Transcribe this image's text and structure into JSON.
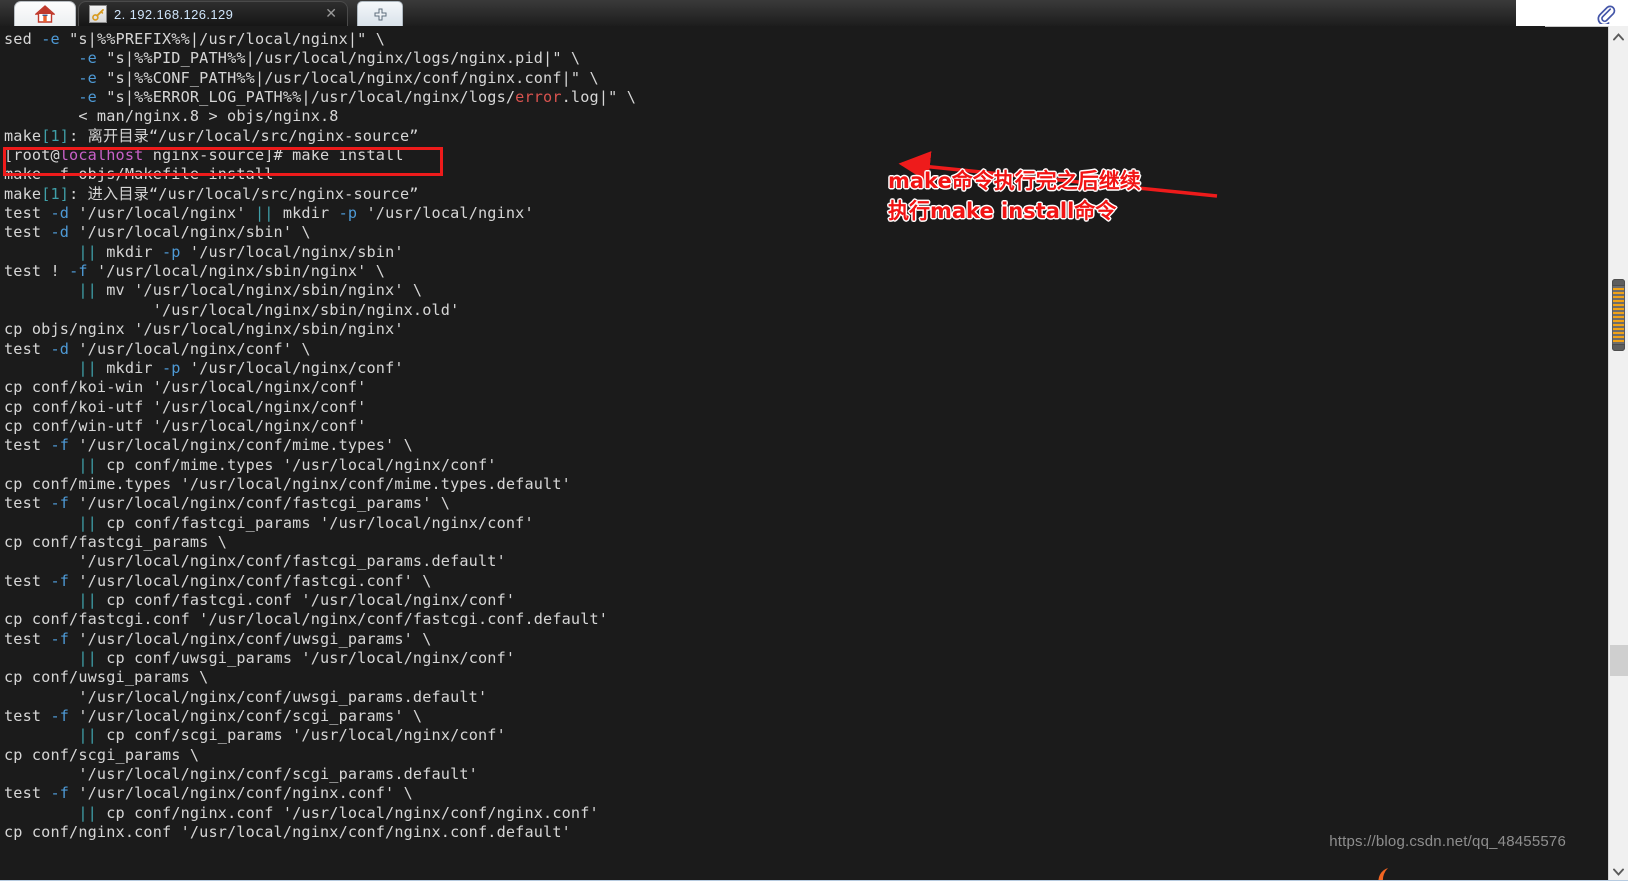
{
  "window": {
    "tabs": [
      {
        "name": "home-tab",
        "icon": "home-icon",
        "label": ""
      },
      {
        "name": "session-tab",
        "icon": "key-icon",
        "label": "2. 192.168.126.129",
        "close_label": "✕"
      },
      {
        "name": "new-tab",
        "icon": "plus-icon",
        "label": ""
      }
    ],
    "attach_icon": "paperclip-icon"
  },
  "terminal": {
    "lines": [
      {
        "segments": [
          {
            "t": "sed ",
            "c": "plain"
          },
          {
            "t": "-e",
            "c": "blue"
          },
          {
            "t": " \"s|%%PREFIX%%|/usr/local/nginx|\" \\",
            "c": "plain"
          }
        ]
      },
      {
        "segments": [
          {
            "t": "        ",
            "c": "plain"
          },
          {
            "t": "-e",
            "c": "blue"
          },
          {
            "t": " \"s|%%PID_PATH%%|/usr/local/nginx/logs/nginx.pid|\" \\",
            "c": "plain"
          }
        ]
      },
      {
        "segments": [
          {
            "t": "        ",
            "c": "plain"
          },
          {
            "t": "-e",
            "c": "blue"
          },
          {
            "t": " \"s|%%CONF_PATH%%|/usr/local/nginx/conf/nginx.conf|\" \\",
            "c": "plain"
          }
        ]
      },
      {
        "segments": [
          {
            "t": "        ",
            "c": "plain"
          },
          {
            "t": "-e",
            "c": "blue"
          },
          {
            "t": " \"s|%%ERROR_LOG_PATH%%|/usr/local/nginx/logs/",
            "c": "plain"
          },
          {
            "t": "error",
            "c": "red"
          },
          {
            "t": ".log|\" \\",
            "c": "plain"
          }
        ]
      },
      {
        "segments": [
          {
            "t": "        < man/nginx.8 > objs/nginx.8",
            "c": "plain"
          }
        ]
      },
      {
        "segments": [
          {
            "t": "make",
            "c": "plain"
          },
          {
            "t": "[1]",
            "c": "cyan"
          },
          {
            "t": ": 离开目录“/usr/local/src/nginx-source”",
            "c": "plain"
          }
        ]
      },
      {
        "segments": [
          {
            "t": "[root@",
            "c": "plain"
          },
          {
            "t": "localhost",
            "c": "pink"
          },
          {
            "t": " nginx-source]# make install",
            "c": "plain"
          }
        ]
      },
      {
        "segments": [
          {
            "t": "make ",
            "c": "plain"
          },
          {
            "t": "-f",
            "c": "plain"
          },
          {
            "t": " objs/Makefile install",
            "c": "plain"
          }
        ]
      },
      {
        "segments": [
          {
            "t": "make",
            "c": "plain"
          },
          {
            "t": "[1]",
            "c": "cyan"
          },
          {
            "t": ": 进入目录“/usr/local/src/nginx-source”",
            "c": "plain"
          }
        ]
      },
      {
        "segments": [
          {
            "t": "test ",
            "c": "plain"
          },
          {
            "t": "-d",
            "c": "blue"
          },
          {
            "t": " '/usr/local/nginx' ",
            "c": "plain"
          },
          {
            "t": "||",
            "c": "cyan"
          },
          {
            "t": " mkdir ",
            "c": "plain"
          },
          {
            "t": "-p",
            "c": "blue"
          },
          {
            "t": " '/usr/local/nginx'",
            "c": "plain"
          }
        ]
      },
      {
        "segments": [
          {
            "t": "test ",
            "c": "plain"
          },
          {
            "t": "-d",
            "c": "blue"
          },
          {
            "t": " '/usr/local/nginx/sbin' \\",
            "c": "plain"
          }
        ]
      },
      {
        "segments": [
          {
            "t": "        ",
            "c": "plain"
          },
          {
            "t": "||",
            "c": "cyan"
          },
          {
            "t": " mkdir ",
            "c": "plain"
          },
          {
            "t": "-p",
            "c": "blue"
          },
          {
            "t": " '/usr/local/nginx/sbin'",
            "c": "plain"
          }
        ]
      },
      {
        "segments": [
          {
            "t": "test ! ",
            "c": "plain"
          },
          {
            "t": "-f",
            "c": "blue"
          },
          {
            "t": " '/usr/local/nginx/sbin/nginx' \\",
            "c": "plain"
          }
        ]
      },
      {
        "segments": [
          {
            "t": "        ",
            "c": "plain"
          },
          {
            "t": "||",
            "c": "cyan"
          },
          {
            "t": " mv '/usr/local/nginx/sbin/nginx' \\",
            "c": "plain"
          }
        ]
      },
      {
        "segments": [
          {
            "t": "                '/usr/local/nginx/sbin/nginx.old'",
            "c": "plain"
          }
        ]
      },
      {
        "segments": [
          {
            "t": "cp objs/nginx '/usr/local/nginx/sbin/nginx'",
            "c": "plain"
          }
        ]
      },
      {
        "segments": [
          {
            "t": "test ",
            "c": "plain"
          },
          {
            "t": "-d",
            "c": "blue"
          },
          {
            "t": " '/usr/local/nginx/conf' \\",
            "c": "plain"
          }
        ]
      },
      {
        "segments": [
          {
            "t": "        ",
            "c": "plain"
          },
          {
            "t": "||",
            "c": "cyan"
          },
          {
            "t": " mkdir ",
            "c": "plain"
          },
          {
            "t": "-p",
            "c": "blue"
          },
          {
            "t": " '/usr/local/nginx/conf'",
            "c": "plain"
          }
        ]
      },
      {
        "segments": [
          {
            "t": "cp conf/koi-win '/usr/local/nginx/conf'",
            "c": "plain"
          }
        ]
      },
      {
        "segments": [
          {
            "t": "cp conf/koi-utf '/usr/local/nginx/conf'",
            "c": "plain"
          }
        ]
      },
      {
        "segments": [
          {
            "t": "cp conf/win-utf '/usr/local/nginx/conf'",
            "c": "plain"
          }
        ]
      },
      {
        "segments": [
          {
            "t": "test ",
            "c": "plain"
          },
          {
            "t": "-f",
            "c": "blue"
          },
          {
            "t": " '/usr/local/nginx/conf/mime.types' \\",
            "c": "plain"
          }
        ]
      },
      {
        "segments": [
          {
            "t": "        ",
            "c": "plain"
          },
          {
            "t": "||",
            "c": "cyan"
          },
          {
            "t": " cp conf/mime.types '/usr/local/nginx/conf'",
            "c": "plain"
          }
        ]
      },
      {
        "segments": [
          {
            "t": "cp conf/mime.types '/usr/local/nginx/conf/mime.types.default'",
            "c": "plain"
          }
        ]
      },
      {
        "segments": [
          {
            "t": "test ",
            "c": "plain"
          },
          {
            "t": "-f",
            "c": "blue"
          },
          {
            "t": " '/usr/local/nginx/conf/fastcgi_params' \\",
            "c": "plain"
          }
        ]
      },
      {
        "segments": [
          {
            "t": "        ",
            "c": "plain"
          },
          {
            "t": "||",
            "c": "cyan"
          },
          {
            "t": " cp conf/fastcgi_params '/usr/local/nginx/conf'",
            "c": "plain"
          }
        ]
      },
      {
        "segments": [
          {
            "t": "cp conf/fastcgi_params \\",
            "c": "plain"
          }
        ]
      },
      {
        "segments": [
          {
            "t": "        '/usr/local/nginx/conf/fastcgi_params.default'",
            "c": "plain"
          }
        ]
      },
      {
        "segments": [
          {
            "t": "test ",
            "c": "plain"
          },
          {
            "t": "-f",
            "c": "blue"
          },
          {
            "t": " '/usr/local/nginx/conf/fastcgi.conf' \\",
            "c": "plain"
          }
        ]
      },
      {
        "segments": [
          {
            "t": "        ",
            "c": "plain"
          },
          {
            "t": "||",
            "c": "cyan"
          },
          {
            "t": " cp conf/fastcgi.conf '/usr/local/nginx/conf'",
            "c": "plain"
          }
        ]
      },
      {
        "segments": [
          {
            "t": "cp conf/fastcgi.conf '/usr/local/nginx/conf/fastcgi.conf.default'",
            "c": "plain"
          }
        ]
      },
      {
        "segments": [
          {
            "t": "test ",
            "c": "plain"
          },
          {
            "t": "-f",
            "c": "blue"
          },
          {
            "t": " '/usr/local/nginx/conf/uwsgi_params' \\",
            "c": "plain"
          }
        ]
      },
      {
        "segments": [
          {
            "t": "        ",
            "c": "plain"
          },
          {
            "t": "||",
            "c": "cyan"
          },
          {
            "t": " cp conf/uwsgi_params '/usr/local/nginx/conf'",
            "c": "plain"
          }
        ]
      },
      {
        "segments": [
          {
            "t": "cp conf/uwsgi_params \\",
            "c": "plain"
          }
        ]
      },
      {
        "segments": [
          {
            "t": "        '/usr/local/nginx/conf/uwsgi_params.default'",
            "c": "plain"
          }
        ]
      },
      {
        "segments": [
          {
            "t": "test ",
            "c": "plain"
          },
          {
            "t": "-f",
            "c": "blue"
          },
          {
            "t": " '/usr/local/nginx/conf/scgi_params' \\",
            "c": "plain"
          }
        ]
      },
      {
        "segments": [
          {
            "t": "        ",
            "c": "plain"
          },
          {
            "t": "||",
            "c": "cyan"
          },
          {
            "t": " cp conf/scgi_params '/usr/local/nginx/conf'",
            "c": "plain"
          }
        ]
      },
      {
        "segments": [
          {
            "t": "cp conf/scgi_params \\",
            "c": "plain"
          }
        ]
      },
      {
        "segments": [
          {
            "t": "        '/usr/local/nginx/conf/scgi_params.default'",
            "c": "plain"
          }
        ]
      },
      {
        "segments": [
          {
            "t": "test ",
            "c": "plain"
          },
          {
            "t": "-f",
            "c": "blue"
          },
          {
            "t": " '/usr/local/nginx/conf/nginx.conf' \\",
            "c": "plain"
          }
        ]
      },
      {
        "segments": [
          {
            "t": "        ",
            "c": "plain"
          },
          {
            "t": "||",
            "c": "cyan"
          },
          {
            "t": " cp conf/nginx.conf '/usr/local/nginx/conf/nginx.conf'",
            "c": "plain"
          }
        ]
      },
      {
        "segments": [
          {
            "t": "cp conf/nginx.conf '/usr/local/nginx/conf/nginx.conf.default'",
            "c": "plain"
          }
        ]
      }
    ]
  },
  "annotation": {
    "text": "make命令执行完之后继续\n执行make install命令",
    "color": "#f21414",
    "highlight_box_color": "#ee1b1b",
    "highlighted_command": "[root@localhost nginx-source]# make install"
  },
  "watermark": {
    "url": "https://blog.csdn.net/qq_48455576"
  },
  "scrollbar": {
    "up_arrow": "chevron-up-icon",
    "down_arrow": "chevron-down-icon",
    "thumb_accent": "#f0a217"
  },
  "colors": {
    "background": "#1b1b1b",
    "foreground": "#d6d6d6",
    "blue": "#4e9ad6",
    "cyan": "#3f9fa8",
    "red": "#d9534f",
    "magenta": "#c861c8"
  }
}
